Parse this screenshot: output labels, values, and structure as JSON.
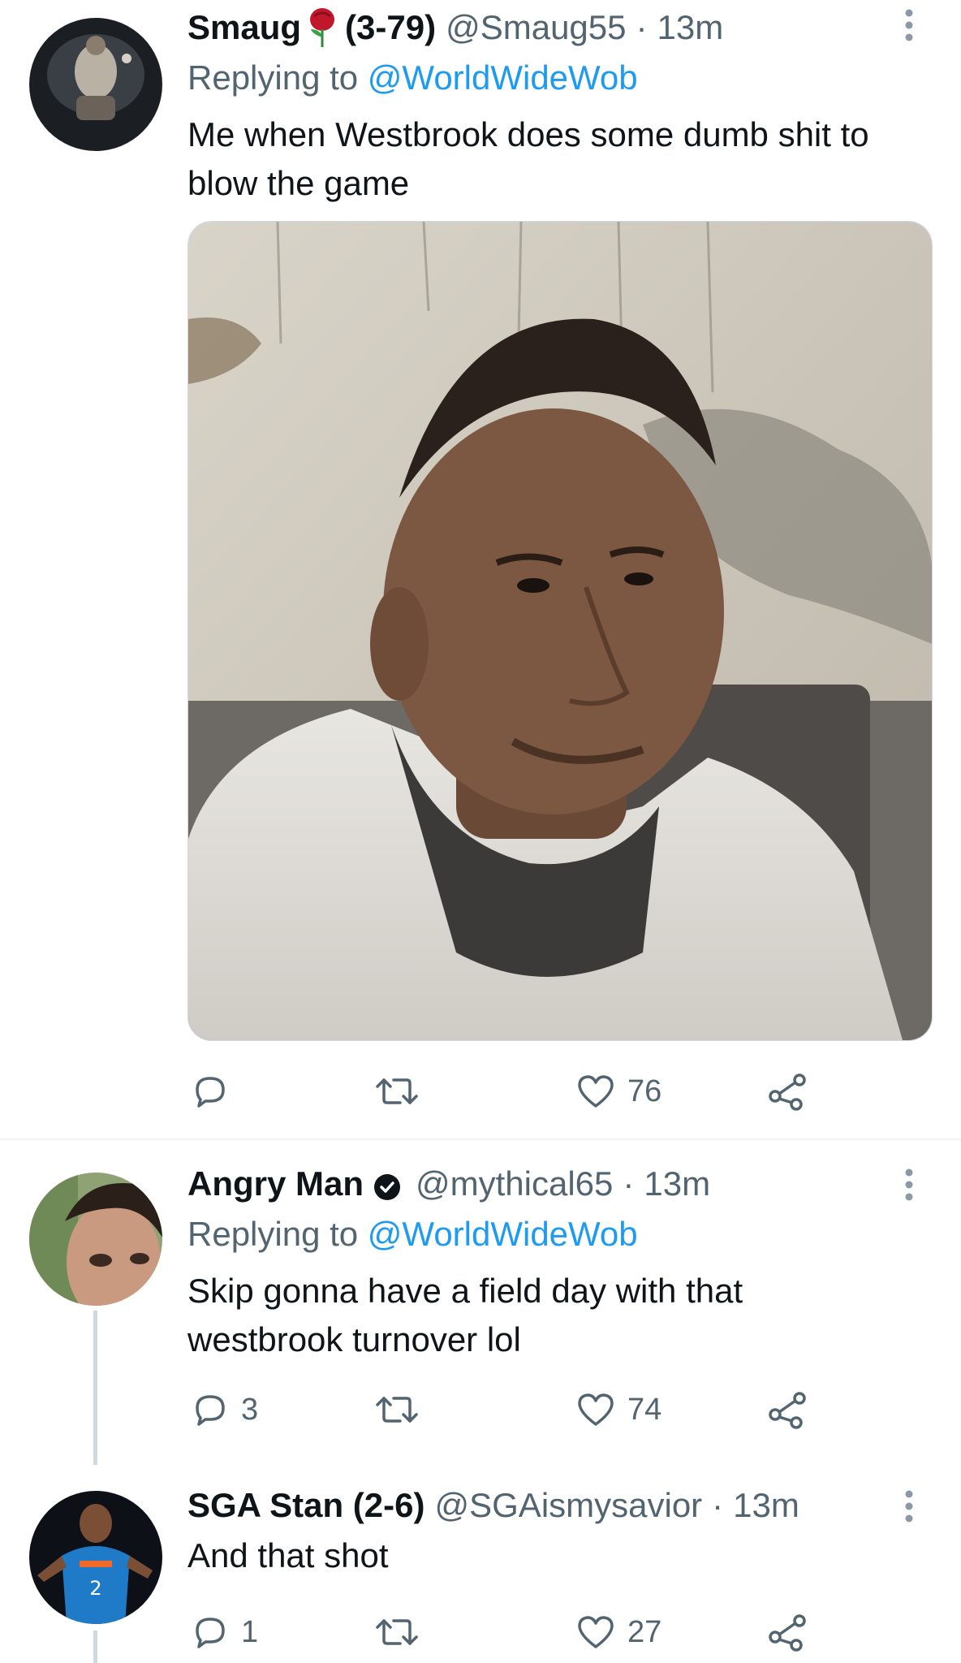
{
  "colors": {
    "link": "#1d9bf0",
    "text": "#0f1419",
    "secondary": "#536471",
    "divider": "#eff3f4"
  },
  "tweets": [
    {
      "name": "Smaug",
      "badge_icon": "rose-icon",
      "name_suffix": "(3-79)",
      "handle": "@Smaug55",
      "separator": "·",
      "time": "13m",
      "replying_prefix": "Replying to",
      "replying_handle": "@WorldWideWob",
      "text_line1": "Me when Westbrook does some dumb shit to",
      "text_line2": "blow the game",
      "has_media": true,
      "counts": {
        "reply": "",
        "retweet": "",
        "like": "76"
      }
    },
    {
      "name": "Angry Man",
      "badge_icon": "verified-icon",
      "handle": "@mythical65",
      "separator": "·",
      "time": "13m",
      "replying_prefix": "Replying to",
      "replying_handle": "@WorldWideWob",
      "text_line1": "Skip gonna have a field day with that",
      "text_line2": "westbrook turnover lol",
      "counts": {
        "reply": "3",
        "retweet": "",
        "like": "74"
      }
    },
    {
      "name": "SGA Stan (2-6)",
      "handle": "@SGAismysavior",
      "separator": "·",
      "time": "13m",
      "text_line1": "And that shot",
      "counts": {
        "reply": "1",
        "retweet": "",
        "like": "27"
      }
    }
  ]
}
